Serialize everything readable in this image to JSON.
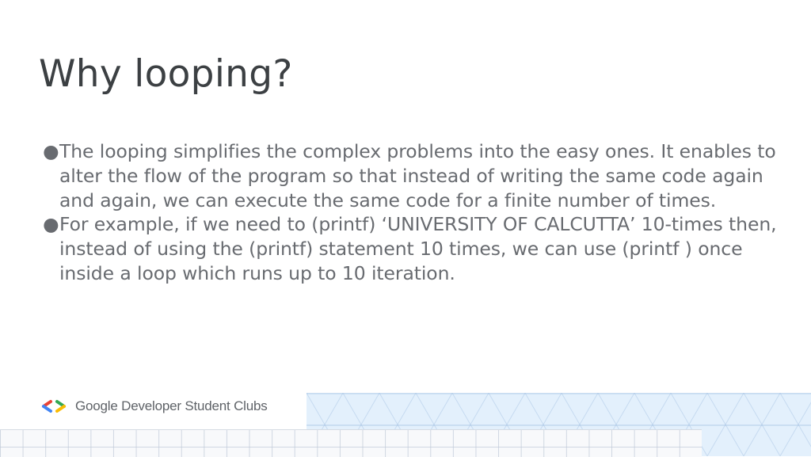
{
  "slide": {
    "title": "Why looping?",
    "bullets": [
      {
        "marker": "●",
        "text": " The looping simplifies the complex problems into the easy ones.  It enables to alter the flow of the program so that instead of writing the same code again and again, we can execute the same code for a finite number of times."
      },
      {
        "marker": "●",
        "text": "For example, if we need to (printf)  ‘UNIVERSITY OF CALCUTTA’ 10-times then, instead of using the (printf) statement 10 times, we can use (printf ) once inside a loop which runs up to 10 iteration."
      }
    ]
  },
  "footer": {
    "logo_icon": "gdsc-brackets-icon",
    "logo_text": "Google Developer Student Clubs",
    "colors": {
      "blue": "#4285f4",
      "red": "#ea4335",
      "green": "#34a853",
      "yellow": "#fbbc04"
    }
  }
}
